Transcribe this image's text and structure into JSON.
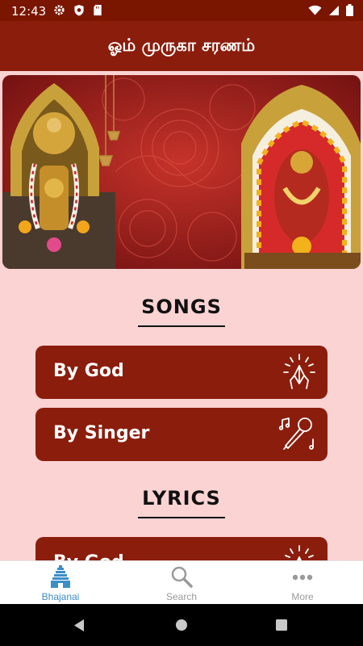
{
  "status_bar": {
    "time": "12:43"
  },
  "app_bar": {
    "title": "ஓம் முருகா சரணம்"
  },
  "sections": {
    "songs": {
      "title": "SONGS",
      "items": [
        {
          "label": "By God",
          "icon": "praying-hands-icon"
        },
        {
          "label": "By Singer",
          "icon": "microphone-music-icon"
        }
      ]
    },
    "lyrics": {
      "title": "LYRICS",
      "items": [
        {
          "label": "By God",
          "icon": "praying-hands-icon"
        }
      ]
    }
  },
  "bottom_nav": {
    "items": [
      {
        "label": "Bhajanai",
        "icon": "temple-icon",
        "active": true
      },
      {
        "label": "Search",
        "icon": "search-icon",
        "active": false
      },
      {
        "label": "More",
        "icon": "more-dots-icon",
        "active": false
      }
    ]
  },
  "colors": {
    "primary": "#8b1d0c",
    "background": "#fcd3d3",
    "status_bar": "#7a1500",
    "nav_active": "#3c8ec8",
    "nav_inactive": "#9a9a9a"
  }
}
